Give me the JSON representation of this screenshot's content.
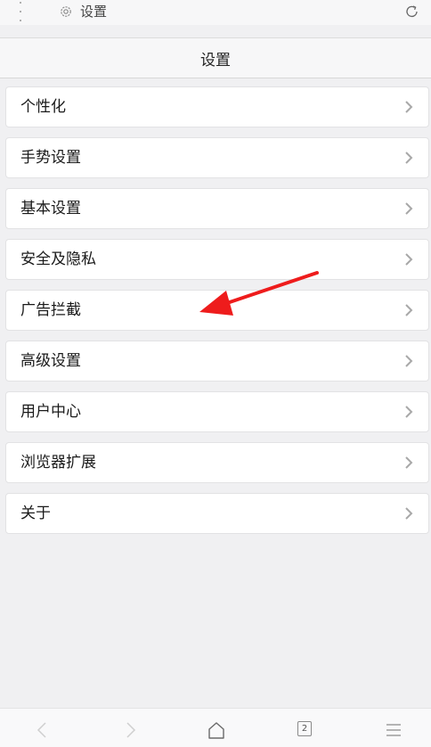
{
  "status_bar": {
    "breadcrumb": "设置",
    "icons": [
      "more-vertical-icon",
      "gear-icon",
      "reload-icon"
    ]
  },
  "header": {
    "title": "设置"
  },
  "settings": {
    "items": [
      {
        "label": "个性化"
      },
      {
        "label": "手势设置"
      },
      {
        "label": "基本设置"
      },
      {
        "label": "安全及隐私"
      },
      {
        "label": "广告拦截"
      },
      {
        "label": "高级设置"
      },
      {
        "label": "用户中心"
      },
      {
        "label": "浏览器扩展"
      },
      {
        "label": "关于"
      }
    ]
  },
  "annotation": {
    "color": "#ee1c1c",
    "target": "广告拦截"
  },
  "bottom_nav": {
    "tab_count": "2",
    "icons": [
      "back-icon",
      "forward-icon",
      "home-icon",
      "tabs-icon",
      "menu-icon"
    ]
  }
}
